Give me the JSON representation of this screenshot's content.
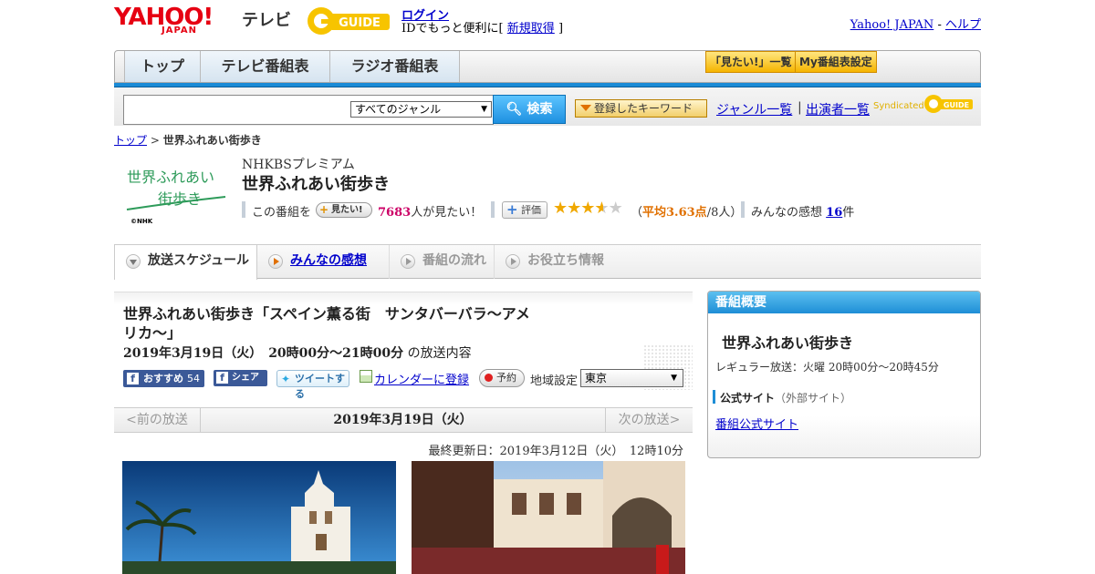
{
  "header": {
    "logo_yahoo": "YAHOO!",
    "logo_japan": "JAPAN",
    "logo_tv": "テレビ",
    "logo_gguide": "GUIDE",
    "login": "ログイン",
    "login_prompt": "IDでもっと便利に[",
    "signup": "新規取得",
    "login_close": "]",
    "yahoo_japan": "Yahoo! JAPAN",
    "dash": "-",
    "help": "ヘルプ"
  },
  "nav": {
    "tabs": [
      "トップ",
      "テレビ番組表",
      "ラジオ番組表"
    ],
    "want_list": "「見たい!」一覧",
    "my_schedule": "My番組表設定"
  },
  "search": {
    "genre": "すべてのジャンル",
    "button": "検索",
    "keyword_button": "登録したキーワード",
    "genre_list": "ジャンル一覧",
    "separator": "|",
    "performers": "出演者一覧",
    "syndicated": "Syndicated",
    "syndicated_logo": "GUIDE"
  },
  "breadcrumb": {
    "top": "トップ",
    "sep": ">",
    "current": "世界ふれあい街歩き"
  },
  "program": {
    "logo_text_1": "世界ふれあい",
    "logo_text_2": "街歩き",
    "nhk_mark": "©NHK",
    "channel": "NHKBSプレミアム",
    "title": "世界ふれあい街歩き",
    "this_program": "この番組を",
    "want_button": "見たい!",
    "want_count": "7683",
    "want_suffix": "人が見たい！",
    "rate_button": "評価",
    "rating": 3.63,
    "stars": [
      "★",
      "★",
      "★",
      "★",
      "★"
    ],
    "avg_open": "（",
    "avg_label": "平均3.63点",
    "avg_count": "/8人）",
    "impressions_label": "みんなの感想",
    "impressions_count": "16",
    "impressions_suffix": "件"
  },
  "tabs": [
    {
      "label": "放送スケジュール"
    },
    {
      "label": "みんなの感想"
    },
    {
      "label": "番組の流れ"
    },
    {
      "label": "お役立ち情報"
    }
  ],
  "episode": {
    "title": "世界ふれあい街歩き「スペイン薫る街　サンタバーバラ～アメリカ～」",
    "datetime": "2019年3月19日（火）　20時00分～21時00分",
    "datetime_suffix": "の放送内容",
    "fb_recommend": "おすすめ",
    "fb_count": "54",
    "fb_share": "シェア",
    "tweet": "ツイートする",
    "calendar": "カレンダーに登録",
    "reserve": "予約",
    "region_label": "地域設定",
    "region": "東京",
    "prev": "<前の放送",
    "current_date": "2019年3月19日（火）",
    "next": "次の放送>",
    "updated": "最終更新日：2019年3月12日（火）　12時10分"
  },
  "side": {
    "header": "番組概要",
    "title": "世界ふれあい街歩き",
    "regular": "レギュラー放送：火曜 20時00分～20時45分",
    "official_label": "公式サイト",
    "official_note": "（外部サイト）",
    "official_link": "番組公式サイト"
  },
  "colors": {
    "yahoo_red": "#e60012",
    "accent_blue": "#1a8bd6",
    "star": "#f0a800",
    "pink": "#cc0066"
  }
}
